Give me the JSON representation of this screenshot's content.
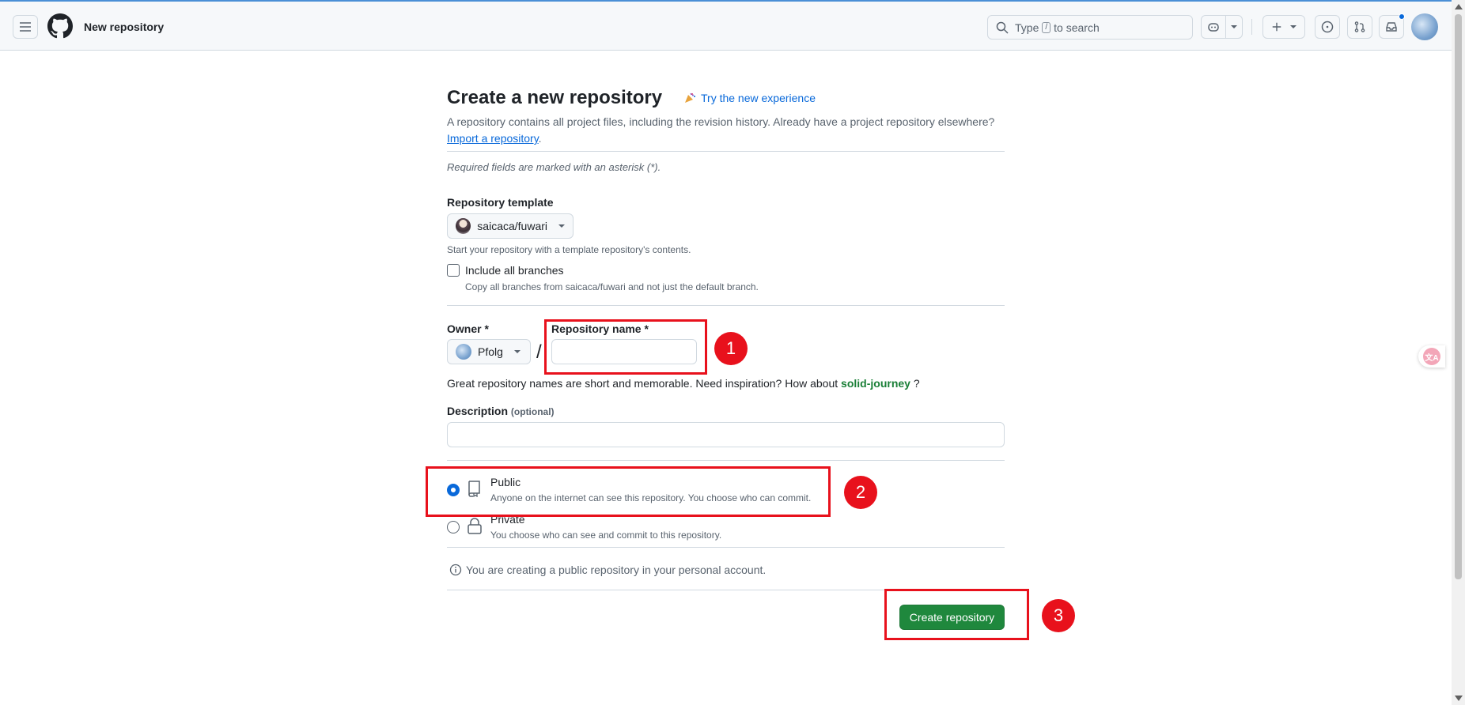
{
  "header": {
    "title": "New repository",
    "search_prefix": "Type",
    "search_key": "/",
    "search_suffix": "to search",
    "icons": [
      "menu-icon",
      "github-logo-icon",
      "search-icon",
      "copilot-icon",
      "plus-icon",
      "issues-icon",
      "pull-requests-icon",
      "inbox-icon"
    ]
  },
  "page": {
    "title": "Create a new repository",
    "try_new": "Try the new experience",
    "intro_text": "A repository contains all project files, including the revision history. Already have a project repository elsewhere?",
    "import_link": "Import a repository",
    "import_suffix": ".",
    "required_note": "Required fields are marked with an asterisk (*)."
  },
  "template": {
    "label": "Repository template",
    "selected": "saicaca/fuwari",
    "hint": "Start your repository with a template repository's contents.",
    "include_branches_label": "Include all branches",
    "include_branches_checked": false,
    "include_branches_hint": "Copy all branches from saicaca/fuwari and not just the default branch."
  },
  "owner": {
    "label": "Owner *",
    "selected": "Pfolg",
    "separator": "/"
  },
  "repo_name": {
    "label": "Repository name *",
    "value": "",
    "hint_prefix": "Great repository names are short and memorable. Need inspiration? How about",
    "suggestion": "solid-journey",
    "hint_suffix": "?"
  },
  "description": {
    "label": "Description",
    "optional": "(optional)",
    "value": ""
  },
  "visibility": {
    "options": [
      {
        "title": "Public",
        "desc": "Anyone on the internet can see this repository. You choose who can commit.",
        "checked": true
      },
      {
        "title": "Private",
        "desc": "You choose who can see and commit to this repository.",
        "checked": false
      }
    ],
    "info": "You are creating a public repository in your personal account."
  },
  "actions": {
    "create_label": "Create repository"
  },
  "annotations": [
    "1",
    "2",
    "3"
  ],
  "colors": {
    "accent": "#0969da",
    "primary_button": "#1f883d",
    "annotation": "#e8111c",
    "suggestion": "#1a7f37"
  }
}
